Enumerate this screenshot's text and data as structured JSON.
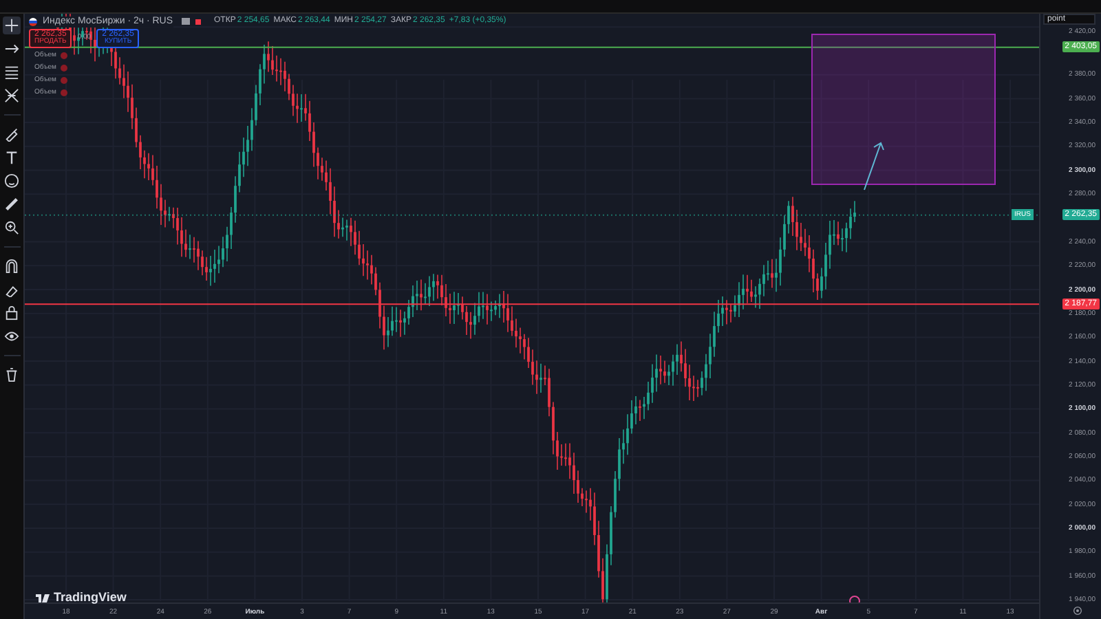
{
  "header": {
    "symbol": "Индекс МосБиржи · 2ч · RUS",
    "ohlc": [
      {
        "label": "ОТКР",
        "value": "2 254,65"
      },
      {
        "label": "МАКС",
        "value": "2 263,44"
      },
      {
        "label": "МИН",
        "value": "2 254,27"
      },
      {
        "label": "ЗАКР",
        "value": "2 262,35"
      }
    ],
    "change": "+7,83 (+0,35%)"
  },
  "trade": {
    "sell": {
      "price": "2 262,35",
      "label": "ПРОДАТЬ"
    },
    "spread": "0,00",
    "buy": {
      "price": "2 262,35",
      "label": "КУПИТЬ"
    }
  },
  "indicators": [
    {
      "label": "Объем"
    },
    {
      "label": "Объем"
    },
    {
      "label": "Объем"
    },
    {
      "label": "Объем"
    }
  ],
  "price_axis": {
    "mode": "point",
    "ticks": [
      {
        "label": "2 420,00",
        "major": false
      },
      {
        "label": "2 380,00",
        "major": false
      },
      {
        "label": "2 360,00",
        "major": false
      },
      {
        "label": "2 340,00",
        "major": false
      },
      {
        "label": "2 320,00",
        "major": false
      },
      {
        "label": "2 300,00",
        "major": true
      },
      {
        "label": "2 280,00",
        "major": false
      },
      {
        "label": "2 240,00",
        "major": false
      },
      {
        "label": "2 220,00",
        "major": false
      },
      {
        "label": "2 200,00",
        "major": true
      },
      {
        "label": "2 180,00",
        "major": false
      },
      {
        "label": "2 160,00",
        "major": false
      },
      {
        "label": "2 140,00",
        "major": false
      },
      {
        "label": "2 120,00",
        "major": false
      },
      {
        "label": "2 100,00",
        "major": true
      },
      {
        "label": "2 080,00",
        "major": false
      },
      {
        "label": "2 060,00",
        "major": false
      },
      {
        "label": "2 040,00",
        "major": false
      },
      {
        "label": "2 020,00",
        "major": false
      },
      {
        "label": "2 000,00",
        "major": true
      },
      {
        "label": "1 980,00",
        "major": false
      },
      {
        "label": "1 960,00",
        "major": false
      },
      {
        "label": "1 940,00",
        "major": false
      }
    ]
  },
  "price_tags": [
    {
      "kind": "line",
      "label": "2 403,05",
      "color": "#4caf50"
    },
    {
      "kind": "last",
      "symbol": "IRUS",
      "label": "2 262,35",
      "color": "#22ab94"
    },
    {
      "kind": "line",
      "label": "2 187,77",
      "color": "#f23645"
    }
  ],
  "time_axis": [
    {
      "label": "18",
      "major": false
    },
    {
      "label": "22",
      "major": false
    },
    {
      "label": "24",
      "major": false
    },
    {
      "label": "26",
      "major": false
    },
    {
      "label": "Июль",
      "major": true
    },
    {
      "label": "3",
      "major": false
    },
    {
      "label": "7",
      "major": false
    },
    {
      "label": "9",
      "major": false
    },
    {
      "label": "11",
      "major": false
    },
    {
      "label": "13",
      "major": false
    },
    {
      "label": "15",
      "major": false
    },
    {
      "label": "17",
      "major": false
    },
    {
      "label": "21",
      "major": false
    },
    {
      "label": "23",
      "major": false
    },
    {
      "label": "27",
      "major": false
    },
    {
      "label": "29",
      "major": false
    },
    {
      "label": "Авг",
      "major": true
    },
    {
      "label": "5",
      "major": false
    },
    {
      "label": "7",
      "major": false
    },
    {
      "label": "11",
      "major": false
    },
    {
      "label": "13",
      "major": false
    }
  ],
  "logo": "TradingView"
}
